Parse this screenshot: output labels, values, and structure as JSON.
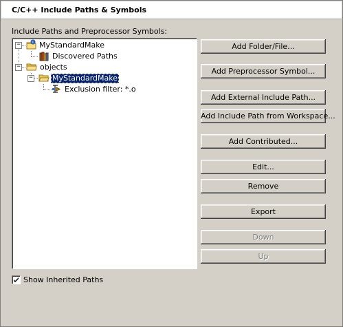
{
  "page": {
    "title": "C/C++ Include Paths & Symbols",
    "section_label": "Include Paths and Preprocessor Symbols:"
  },
  "tree": {
    "root1": {
      "label": "MyStandardMake",
      "icon": "project-icon",
      "expanded": true
    },
    "discovered": {
      "label": "Discovered Paths",
      "icon": "library-icon"
    },
    "root2": {
      "label": "objects",
      "icon": "folder-icon",
      "expanded": true
    },
    "selected": {
      "label": "MyStandardMake",
      "icon": "folder-open-icon",
      "expanded": true,
      "selected": true
    },
    "filter": {
      "label": "Exclusion filter: *.o",
      "icon": "filter-icon"
    }
  },
  "buttons": {
    "add_folder_file": {
      "label": "Add Folder/File...",
      "enabled": true
    },
    "add_preprocessor_symbol": {
      "label": "Add Preprocessor Symbol...",
      "enabled": true
    },
    "add_external_include_path": {
      "label": "Add External Include Path...",
      "enabled": true
    },
    "add_include_path_workspace": {
      "label": "Add Include Path from Workspace...",
      "enabled": true
    },
    "add_contributed": {
      "label": "Add Contributed...",
      "enabled": true
    },
    "edit": {
      "label": "Edit...",
      "enabled": true
    },
    "remove": {
      "label": "Remove",
      "enabled": true
    },
    "export": {
      "label": "Export",
      "enabled": true
    },
    "down": {
      "label": "Down",
      "enabled": false
    },
    "up": {
      "label": "Up",
      "enabled": false
    }
  },
  "show_inherited": {
    "label": "Show Inherited Paths",
    "checked": true
  },
  "colors": {
    "selection_bg": "#0a246a",
    "dialog_bg": "#d4d0c8",
    "disabled_text": "#808080"
  }
}
